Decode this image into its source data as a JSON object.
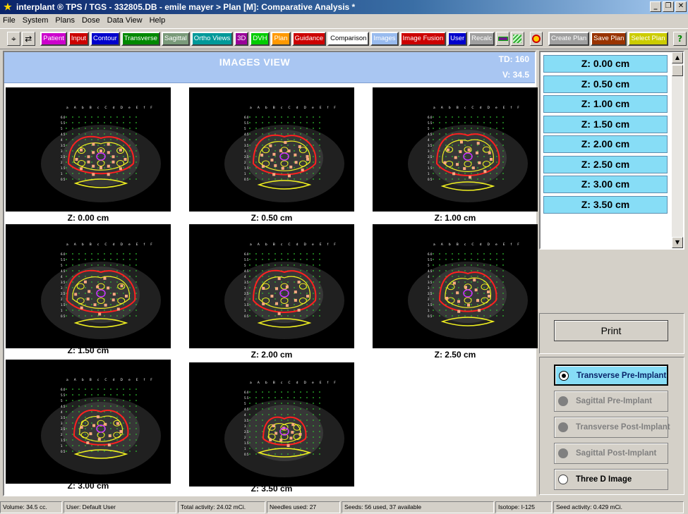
{
  "window": {
    "title": "interplant ® TPS / TGS   - 332805.DB -   emile mayer   > Plan [M]: Comparative Analysis *",
    "minimize": "_",
    "restore": "❐",
    "close": "✕"
  },
  "menu": [
    "File",
    "System",
    "Plans",
    "Dose",
    "Data View",
    "Help"
  ],
  "toolbar": {
    "icon_buttons": [
      {
        "name": "select-icon",
        "glyph": "⌖"
      },
      {
        "name": "transfer-icon",
        "glyph": "⇄"
      }
    ],
    "buttons": [
      {
        "label": "Patient",
        "bg": "#cc00cc",
        "fg": "#ffffff"
      },
      {
        "label": "Input",
        "bg": "#cc0000",
        "fg": "#ffffff"
      },
      {
        "label": "Contour",
        "bg": "#0000cc",
        "fg": "#ffffff"
      },
      {
        "label": "Transverse",
        "bg": "#008800",
        "fg": "#ffffff"
      },
      {
        "label": "Sagittal",
        "bg": "#7a9a7a",
        "fg": "#ffffff"
      },
      {
        "label": "Ortho Views",
        "bg": "#009999",
        "fg": "#ffffff"
      },
      {
        "label": "3D",
        "bg": "#990099",
        "fg": "#ffffff"
      },
      {
        "label": "DVH",
        "bg": "#00cc00",
        "fg": "#ffffff"
      },
      {
        "label": "Plan",
        "bg": "#ff9900",
        "fg": "#ffffff"
      },
      {
        "label": "Guidance",
        "bg": "#cc0000",
        "fg": "#ffffff"
      },
      {
        "label": "Comparison",
        "bg": "#ffffff",
        "fg": "#000000"
      },
      {
        "label": "Images",
        "bg": "#99bbee",
        "fg": "#ffffff"
      },
      {
        "label": "Image Fusion",
        "bg": "#cc0000",
        "fg": "#ffffff"
      },
      {
        "label": "User",
        "bg": "#0000cc",
        "fg": "#ffffff"
      },
      {
        "label": "Recalc",
        "bg": "#a0a0a0",
        "fg": "#ffffff"
      }
    ],
    "right_buttons": [
      {
        "label": "Create Plan",
        "bg": "#a0a0a0",
        "fg": "#ffffff"
      },
      {
        "label": "Save Plan",
        "bg": "#993300",
        "fg": "#ffffff"
      },
      {
        "label": "Select Plan",
        "bg": "#cccc00",
        "fg": "#ffffff"
      }
    ],
    "help_glyph": "?"
  },
  "images_view": {
    "title": "IMAGES VIEW",
    "td": "TD: 160",
    "volume": "V: 34.5",
    "tiles": [
      {
        "label": "Z: 0.00 cm"
      },
      {
        "label": "Z: 0.50 cm"
      },
      {
        "label": "Z: 1.00 cm"
      },
      {
        "label": "Z: 1.50 cm"
      },
      {
        "label": "Z: 2.00 cm"
      },
      {
        "label": "Z: 2.50 cm"
      },
      {
        "label": "Z: 3.00 cm"
      },
      {
        "label": "Z: 3.50 cm"
      }
    ]
  },
  "z_list": [
    "Z: 0.00 cm",
    "Z: 0.50 cm",
    "Z: 1.00 cm",
    "Z: 1.50 cm",
    "Z: 2.00 cm",
    "Z: 2.50 cm",
    "Z: 3.00 cm",
    "Z: 3.50 cm"
  ],
  "print_label": "Print",
  "view_options": [
    {
      "label": "Transverse Pre-Implant",
      "state": "selected"
    },
    {
      "label": "Sagittal Pre-Implant",
      "state": "disabled"
    },
    {
      "label": "Transverse Post-Implant",
      "state": "disabled"
    },
    {
      "label": "Sagittal Post-Implant",
      "state": "disabled"
    },
    {
      "label": "Three D Image",
      "state": "enabled"
    }
  ],
  "status": {
    "volume": "Volume: 34.5 cc.",
    "user": "User: Default User",
    "total_activity": "Total activity: 24.02 mCi.",
    "needles": "Needles used: 27",
    "seeds": "Seeds: 56 used, 37 available",
    "isotope": "Isotope: I-125",
    "seed_activity": "Seed activity: 0.429 mCi."
  },
  "grid_labels": {
    "columns": "a A b B c C d D e E f F",
    "rows": [
      "6.0",
      "5.5",
      "5",
      "4.5",
      "4",
      "3.5",
      "3",
      "2.5",
      "2",
      "1.5",
      "1",
      "0.5"
    ]
  },
  "colors": {
    "title_gradient_start": "#0a246a",
    "header_blue": "#a9c6f2",
    "z_item_cyan": "#87ddf6",
    "contour_red": "#ff2020",
    "contour_yellow": "#f0f020",
    "seed_orange": "#ffaa80",
    "urethra_magenta": "#cc33ff",
    "grid_green": "#30c030"
  }
}
